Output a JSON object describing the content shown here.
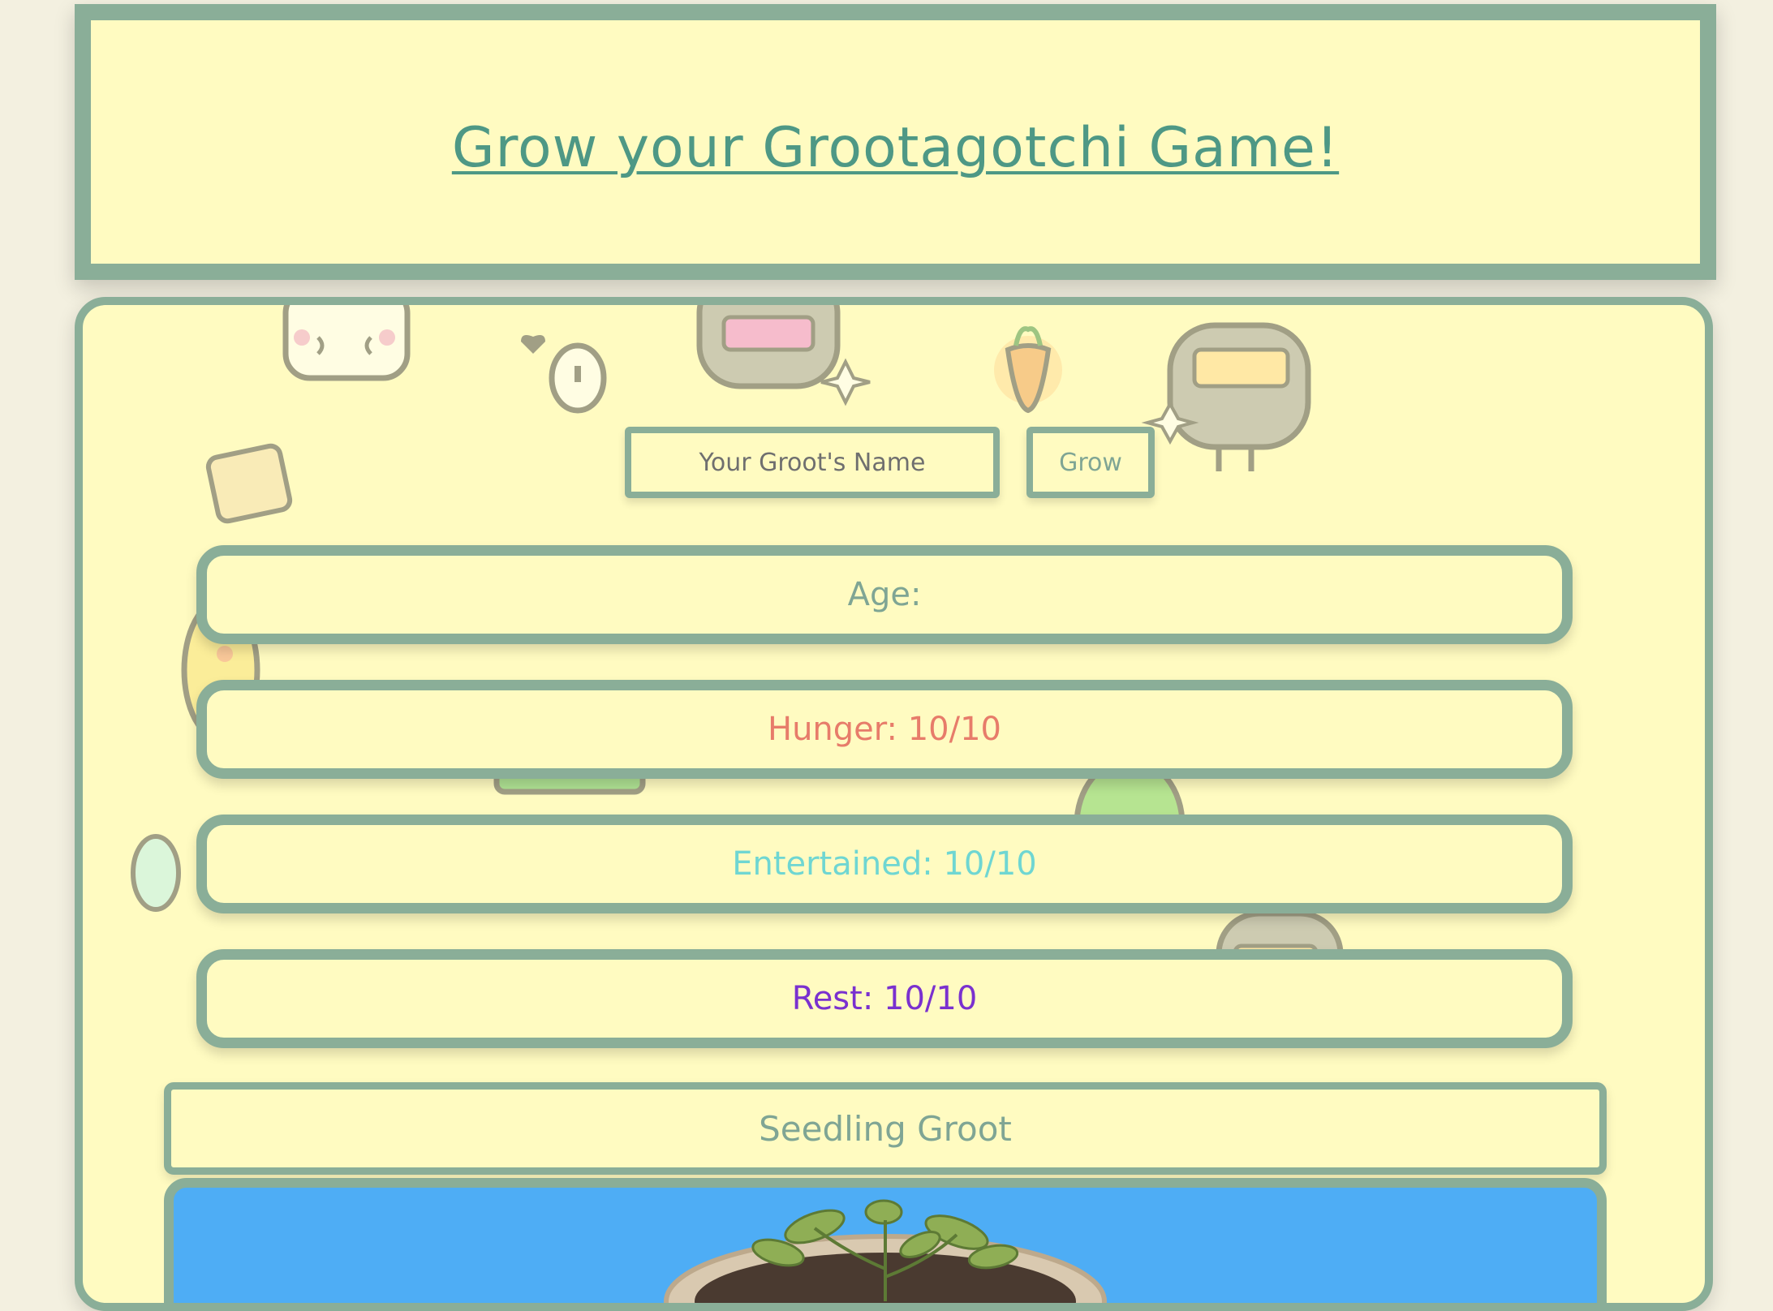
{
  "header": {
    "title": "Grow your Grootagotchi Game!"
  },
  "controls": {
    "name_placeholder": "Your Groot's Name",
    "grow_label": "Grow"
  },
  "stats": {
    "age": "Age:",
    "hunger": "Hunger: 10/10",
    "entertained": "Entertained: 10/10",
    "rest": "Rest: 10/10"
  },
  "stage": {
    "label": "Seedling Groot"
  },
  "colors": {
    "border": "#8aae98",
    "panel": "#fffbc1",
    "title": "#4e9885",
    "hunger": "#e77c6a",
    "entertained": "#6fd6d2",
    "rest": "#7a31cf",
    "sky": "#4eadf5"
  },
  "background_stickers": [
    "robot-sticker",
    "egg-sticker",
    "carrot-sticker",
    "bunny-sticker",
    "toast-sticker",
    "ghost-sticker",
    "basket-sticker",
    "blob-sticker"
  ],
  "plant_image": "seedling-in-pot"
}
